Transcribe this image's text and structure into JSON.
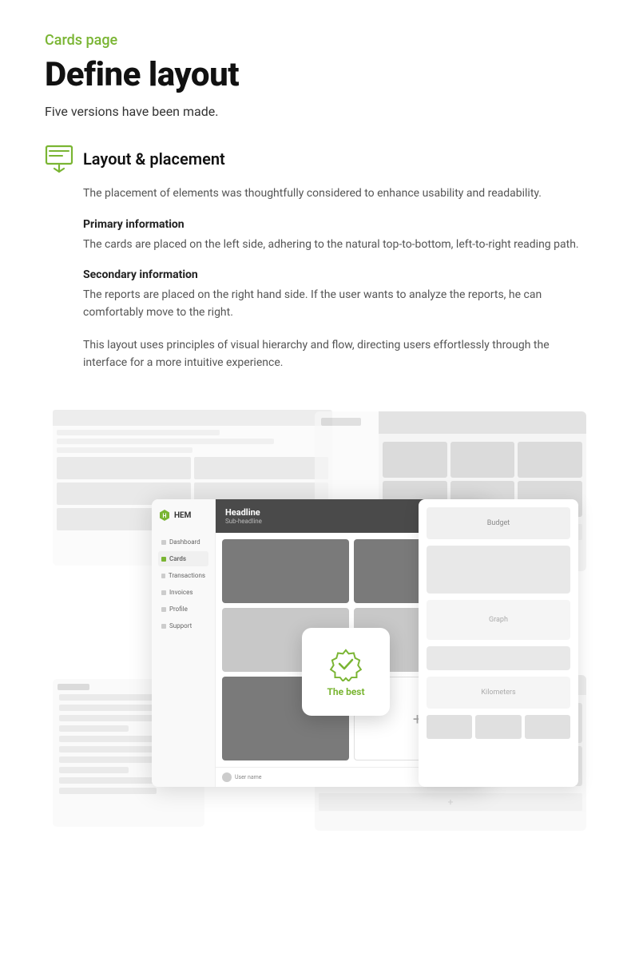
{
  "header": {
    "category": "Cards page",
    "title": "Define layout",
    "subtitle": "Five versions have been made."
  },
  "section": {
    "title": "Layout & placement",
    "intro": "The placement of elements was thoughtfully considered to enhance usability and readability.",
    "subsections": [
      {
        "title": "Primary information",
        "text": "The cards are placed on the left side, adhering to the natural top-to-bottom, left-to-right reading path."
      },
      {
        "title": "Secondary information",
        "text": "The reports are placed on the right hand side. If the user wants to analyze the reports, he can comfortably move to the right."
      }
    ],
    "closing": "This layout uses principles of visual hierarchy and flow, directing users effortlessly through the interface for a more intuitive experience."
  },
  "mockup": {
    "logo_text": "HEM",
    "headline": "Headline",
    "subheadline": "Sub-headline",
    "nav_items": [
      {
        "label": "Dashboard",
        "active": false
      },
      {
        "label": "Cards",
        "active": true
      },
      {
        "label": "Transactions",
        "active": false
      },
      {
        "label": "Invoices",
        "active": false
      },
      {
        "label": "Profile",
        "active": false
      },
      {
        "label": "Support",
        "active": false
      }
    ],
    "user_label": "User name",
    "badge_text": "The best",
    "budget_label": "Budget",
    "graph_label": "Graph",
    "km_label": "Kilometers",
    "plus_symbol": "+"
  },
  "colors": {
    "accent": "#7ab533",
    "dark_header": "#4a4a4a",
    "card_grey": "#7a7a7a",
    "bg_light": "#f9f9f9"
  }
}
